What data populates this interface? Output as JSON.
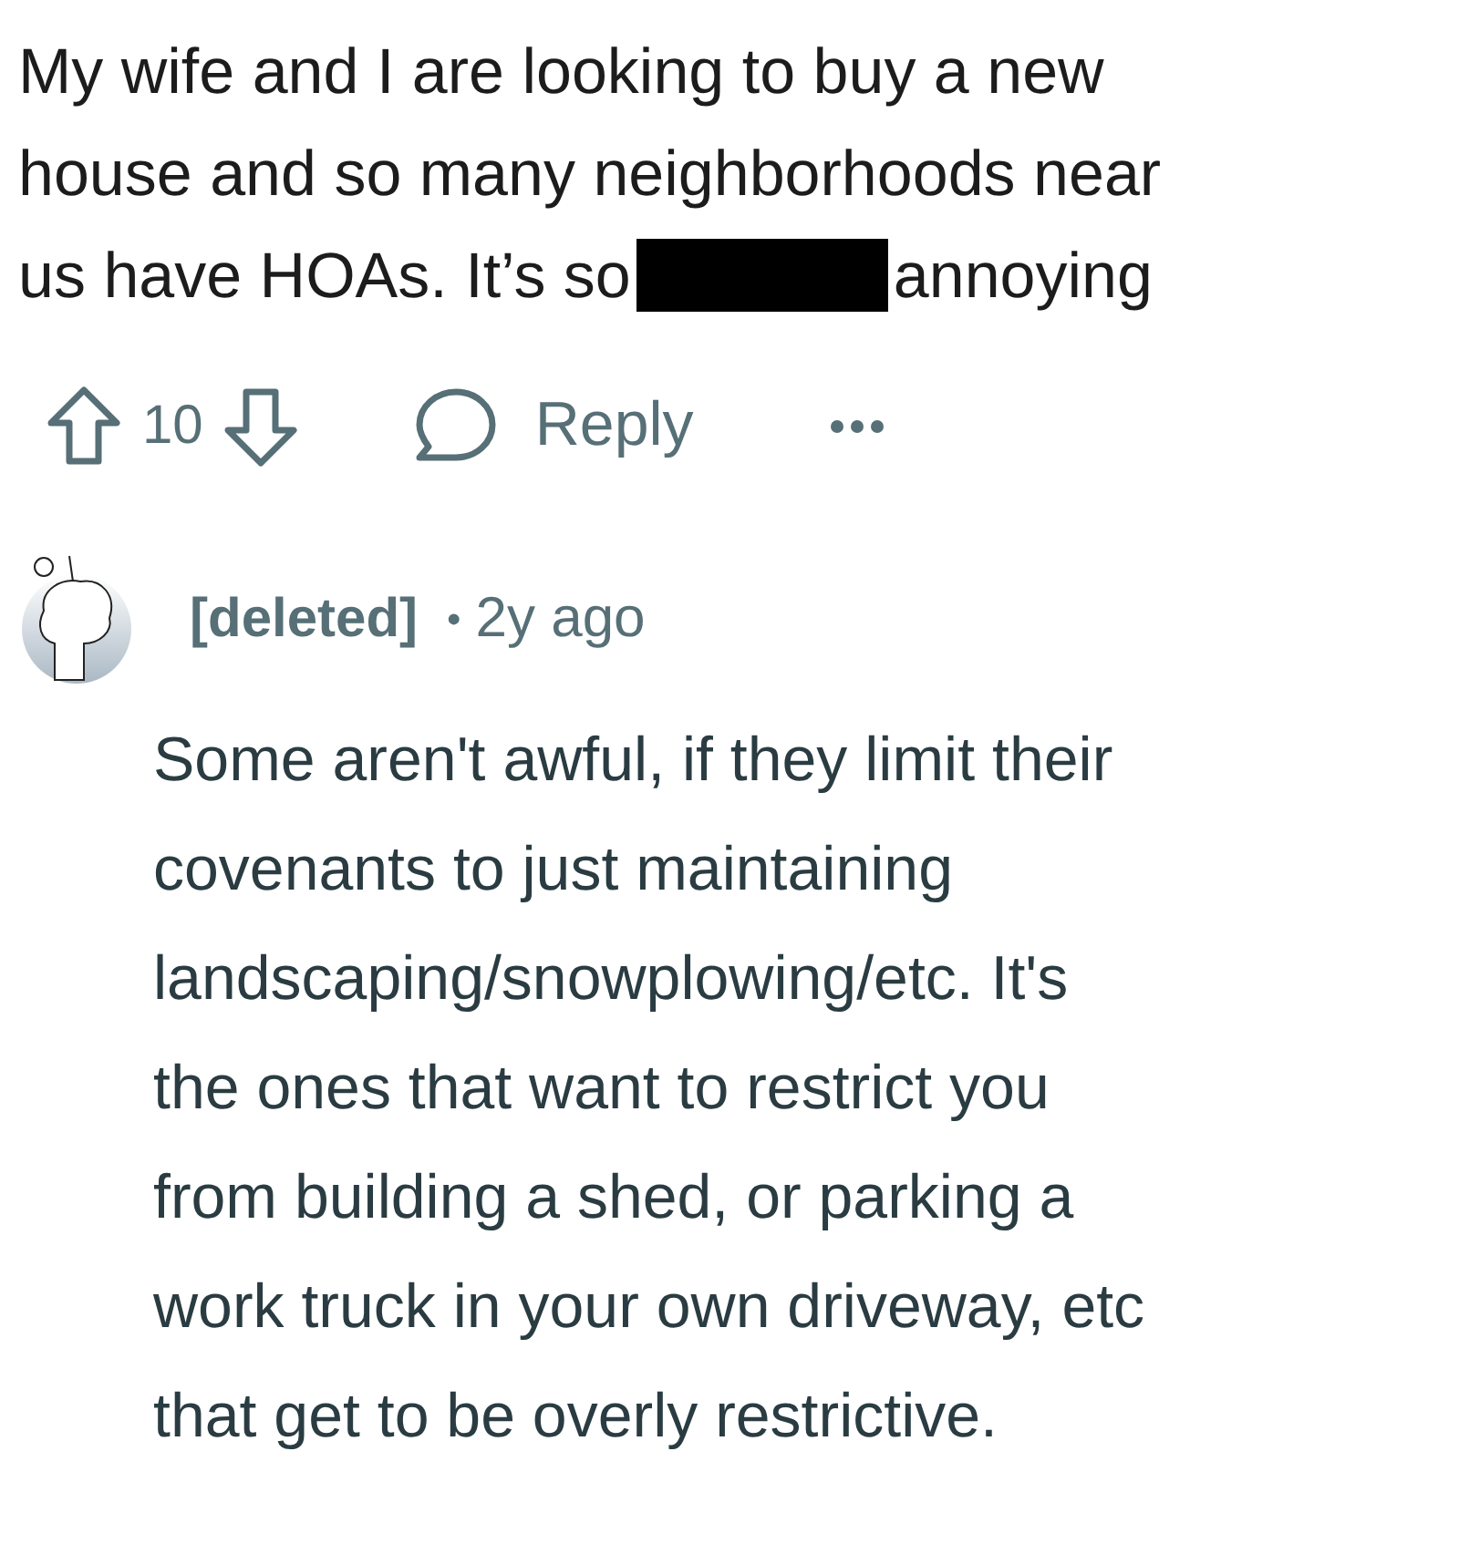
{
  "post": {
    "lines": [
      "My wife and I are looking to buy a new",
      "house and so many neighborhoods near",
      "us have HOAs. It’s so"
    ],
    "redacted": true,
    "text_after": "annoying"
  },
  "actions": {
    "score": "10",
    "reply": "Reply"
  },
  "comment": {
    "author": "[deleted]",
    "separator": "•",
    "time": "2y ago",
    "lines": [
      "Some aren't awful, if they limit their",
      "covenants to just maintaining",
      "landscaping/snowplowing/etc. It's",
      "the ones that want to restrict you",
      "from building a shed, or parking a",
      "work truck in your own driveway, etc",
      "that get to be overly restrictive."
    ]
  }
}
